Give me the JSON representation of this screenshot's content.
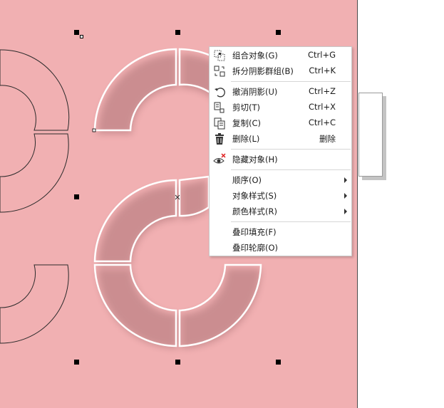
{
  "canvas": {
    "page_color": "#f1b0b2",
    "outside_color": "#ffffff"
  },
  "context_menu": {
    "items": [
      {
        "label": "组合对象(G)",
        "shortcut": "Ctrl+G",
        "icon": "group-icon"
      },
      {
        "label": "拆分阴影群组(B)",
        "shortcut": "Ctrl+K",
        "icon": "break-apart-icon"
      },
      {
        "label": "撤消阴影(U)",
        "shortcut": "Ctrl+Z",
        "icon": "undo-icon"
      },
      {
        "label": "剪切(T)",
        "shortcut": "Ctrl+X",
        "icon": "cut-icon"
      },
      {
        "label": "复制(C)",
        "shortcut": "Ctrl+C",
        "icon": "copy-icon"
      },
      {
        "label": "删除(L)",
        "shortcut": "删除",
        "icon": "trash-icon"
      },
      {
        "label": "隐藏对象(H)",
        "shortcut": "",
        "icon": "hide-eye-icon"
      },
      {
        "label": "顺序(O)",
        "shortcut": "",
        "icon": "",
        "submenu": true
      },
      {
        "label": "对象样式(S)",
        "shortcut": "",
        "icon": "",
        "submenu": true
      },
      {
        "label": "颜色样式(R)",
        "shortcut": "",
        "icon": "",
        "submenu": true
      },
      {
        "label": "叠印填充(F)",
        "shortcut": "",
        "icon": ""
      },
      {
        "label": "叠印轮廓(O)",
        "shortcut": "",
        "icon": ""
      }
    ]
  }
}
